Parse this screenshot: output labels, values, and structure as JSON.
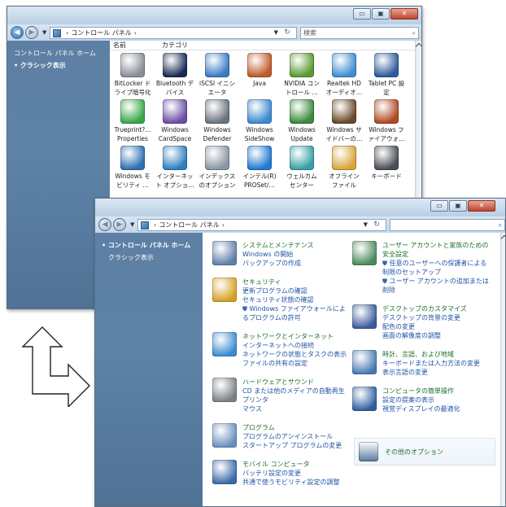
{
  "classic_window": {
    "caption_buttons": {
      "minimize": "▭",
      "maximize": "▣",
      "close": "✕"
    },
    "breadcrumb": [
      "コントロール パネル"
    ],
    "search_placeholder": "検索",
    "sidebar": {
      "items": [
        {
          "label": "コントロール パネル ホーム",
          "active": false
        },
        {
          "label": "クラシック表示",
          "active": true
        }
      ]
    },
    "columns": [
      "名前",
      "カテゴリ"
    ],
    "items": [
      {
        "label": "BitLocker ド\nライブ暗号化",
        "icon": "bitlocker-icon",
        "color": "#8a8e96"
      },
      {
        "label": "Bluetooth デ\nバイス",
        "icon": "bluetooth-icon",
        "color": "#1a2b55"
      },
      {
        "label": "iSCSI イニシ\nエータ",
        "icon": "iscsi-icon",
        "color": "#3d7ac4"
      },
      {
        "label": "Java",
        "icon": "java-icon",
        "color": "#c05a28"
      },
      {
        "label": "NVIDIA コン\nトロール …",
        "icon": "nvidia-icon",
        "color": "#5a9a30"
      },
      {
        "label": "Realtek HD\nオーディオ…",
        "icon": "realtek-icon",
        "color": "#3f8fd0"
      },
      {
        "label": "Tablet PC 設\n定",
        "icon": "tablet-pc-icon",
        "color": "#2e5b9e"
      },
      {
        "label": "Trueprint?...\nProperties",
        "icon": "trueprint-icon",
        "color": "#3aa84a"
      },
      {
        "label": "Windows\nCardSpace",
        "icon": "cardspace-icon",
        "color": "#6c4fa8"
      },
      {
        "label": "Windows\nDefender",
        "icon": "defender-icon",
        "color": "#6b7480"
      },
      {
        "label": "Windows\nSideShow",
        "icon": "sideshow-icon",
        "color": "#3a8ad2"
      },
      {
        "label": "Windows\nUpdate",
        "icon": "windows-update-icon",
        "color": "#3c8a3e"
      },
      {
        "label": "Windows サ\nイドバーの…",
        "icon": "sidebar-icon",
        "color": "#6a4a2a"
      },
      {
        "label": "Windows フ\nァイアウォ…",
        "icon": "firewall-icon",
        "color": "#b04a22"
      },
      {
        "label": "Windows モ\nビリティ …",
        "icon": "mobility-icon",
        "color": "#2f6fb0"
      },
      {
        "label": "インターネッ\nト オプショ…",
        "icon": "internet-options-icon",
        "color": "#2f7fbf"
      },
      {
        "label": "インデックス\nのオプション",
        "icon": "indexing-icon",
        "color": "#8a96a4"
      },
      {
        "label": "インテル(R)\nPROSet/…",
        "icon": "intel-proset-icon",
        "color": "#1f7ad0"
      },
      {
        "label": "ウェルカム\nセンター",
        "icon": "welcome-center-icon",
        "color": "#3aa0a8"
      },
      {
        "label": "オフライン\nファイル",
        "icon": "offline-files-icon",
        "color": "#d8a53a"
      },
      {
        "label": "キーボード",
        "icon": "keyboard-icon",
        "color": "#4a4e56"
      }
    ]
  },
  "home_window": {
    "caption_buttons": {
      "minimize": "▭",
      "maximize": "▣",
      "close": "✕"
    },
    "breadcrumb": [
      "コントロール パネル"
    ],
    "sidebar": {
      "items": [
        {
          "label": "コントロール パネル ホーム",
          "active": true
        },
        {
          "label": "クラシック表示",
          "active": false
        }
      ]
    },
    "left_categories": [
      {
        "title": "システムとメンテナンス",
        "icon": "system-maintenance-icon",
        "color": "#5f7fa8",
        "links": [
          {
            "text": "Windows の開始",
            "shield": false
          },
          {
            "text": "バックアップの作成",
            "shield": false
          }
        ]
      },
      {
        "title": "セキュリティ",
        "icon": "security-shield-icon",
        "color": "#d4a022",
        "links": [
          {
            "text": "更新プログラムの確認",
            "shield": false
          },
          {
            "text": "セキュリティ状態の確認",
            "shield": false
          },
          {
            "text": "Windows ファイアウォールによ\nるプログラムの許可",
            "shield": true
          }
        ]
      },
      {
        "title": "ネットワークとインターネット",
        "icon": "network-globe-icon",
        "color": "#3c8ad0",
        "links": [
          {
            "text": "インターネットへの接続",
            "shield": false
          },
          {
            "text": "ネットワークの状態とタスクの表示",
            "shield": false
          },
          {
            "text": "ファイルの共有の設定",
            "shield": false
          }
        ]
      },
      {
        "title": "ハードウェアとサウンド",
        "icon": "hardware-printer-icon",
        "color": "#7a8088",
        "links": [
          {
            "text": "CD または他のメディアの自動再生",
            "shield": false
          },
          {
            "text": "プリンタ",
            "shield": false
          },
          {
            "text": "マウス",
            "shield": false
          }
        ]
      },
      {
        "title": "プログラム",
        "icon": "programs-icon",
        "color": "#6a8fbf",
        "links": [
          {
            "text": "プログラムのアンインストール",
            "shield": false
          },
          {
            "text": "スタートアップ プログラムの変更",
            "shield": false
          }
        ]
      },
      {
        "title": "モバイル コンピュータ",
        "icon": "mobile-pc-icon",
        "color": "#3a6aa8",
        "links": [
          {
            "text": "バッテリ設定の変更",
            "shield": false
          },
          {
            "text": "共通で使うモビリティ設定の調整",
            "shield": false
          }
        ]
      }
    ],
    "right_categories": [
      {
        "title": "ユーザー アカウントと家族のための\n安全設定",
        "icon": "user-accounts-icon",
        "color": "#4a8a5a",
        "links": [
          {
            "text": "任意のユーザーへの保護者による\n制限のセットアップ",
            "shield": true
          },
          {
            "text": "ユーザー アカウントの追加または\n削除",
            "shield": true
          }
        ]
      },
      {
        "title": "デスクトップのカスタマイズ",
        "icon": "appearance-icon",
        "color": "#3a5a9a",
        "links": [
          {
            "text": "デスクトップの背景の変更",
            "shield": false
          },
          {
            "text": "配色の変更",
            "shield": false
          },
          {
            "text": "画面の解像度の調整",
            "shield": false
          }
        ]
      },
      {
        "title": "時計、言語、および地域",
        "icon": "clock-globe-icon",
        "color": "#4a7ab0",
        "links": [
          {
            "text": "キーボードまたは入力方法の変更",
            "shield": false
          },
          {
            "text": "表示言語の変更",
            "shield": false
          }
        ]
      },
      {
        "title": "コンピュータの簡単操作",
        "icon": "ease-of-access-icon",
        "color": "#2f5fa0",
        "links": [
          {
            "text": "設定の提案の表示",
            "shield": false
          },
          {
            "text": "視覚ディスプレイの最適化",
            "shield": false
          }
        ]
      }
    ],
    "more_options": {
      "title": "その他のオプション",
      "icon": "additional-options-icon",
      "color": "#5a7a9a"
    }
  }
}
